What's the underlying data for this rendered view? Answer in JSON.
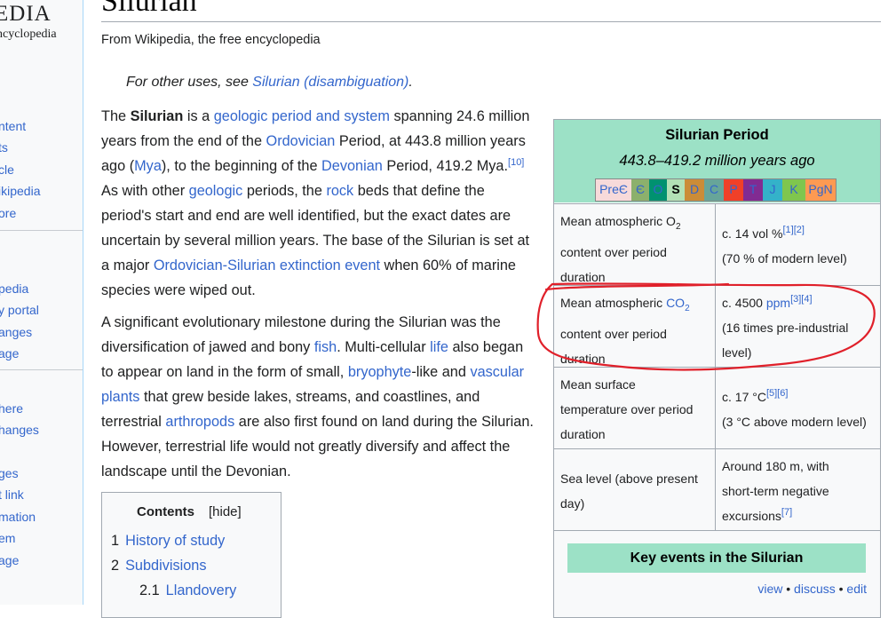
{
  "sidebar": {
    "logo_top": "EDIA",
    "logo_bottom": "ncyclopedia",
    "group1": [
      "ntent",
      "ts",
      "cle",
      "ikipedia",
      "ore"
    ],
    "group2": [
      "pedia",
      "y portal",
      "anges",
      "age"
    ],
    "group3": [
      "here",
      "hanges"
    ],
    "group4": [
      "ges",
      "t link",
      "mation",
      "em",
      "age"
    ]
  },
  "article": {
    "title": "Silurian",
    "tagline": "From Wikipedia, the free encyclopedia",
    "hatnote_prefix": "For other uses, see ",
    "hatnote_link": "Silurian (disambiguation)",
    "hatnote_suffix": ".",
    "p1": [
      "The ",
      "Silurian",
      " is a ",
      "geologic period and system",
      " spanning 24.6 million years from the end of the ",
      "Ordovician",
      " Period, at 443.8 million years ago (",
      "Mya",
      "), to the beginning of the ",
      "Devonian",
      " Period, 419.2 Mya.",
      "[10]",
      " As with other ",
      "geologic",
      " periods, the ",
      "rock",
      " beds that define the period's start and end are well identified, but the exact dates are uncertain by several million years. The base of the Silurian is set at a major ",
      "Ordovician-Silurian extinction event",
      " when 60% of marine species were wiped out."
    ],
    "p2": [
      "A significant evolutionary milestone during the Silurian was the diversification of jawed and bony ",
      "fish",
      ". Multi-cellular ",
      "life",
      " also began to appear on land in the form of small, ",
      "bryophyte",
      "-like and ",
      "vascular plants",
      " that grew beside lakes, streams, and coastlines, and terrestrial ",
      "arthropods",
      " are also first found on land during the Silurian. However, terrestrial life would not greatly diversify and affect the landscape until the Devonian."
    ]
  },
  "toc": {
    "heading": "Contents",
    "hide": "[hide]",
    "items": [
      {
        "num": "1",
        "label": "History of study"
      },
      {
        "num": "2",
        "label": "Subdivisions"
      },
      {
        "num": "2.1",
        "label": "Llandovery"
      }
    ]
  },
  "infobox": {
    "title": "Silurian Period",
    "subtitle": "443.8–419.2 million years ago",
    "timescale": [
      {
        "label": "PreЄ",
        "color": "#f7dada"
      },
      {
        "label": "Є",
        "color": "#8cb06c"
      },
      {
        "label": "O",
        "color": "#009270"
      },
      {
        "label": "S",
        "color": "#b3e1b6"
      },
      {
        "label": "D",
        "color": "#cb8c37"
      },
      {
        "label": "C",
        "color": "#67a599"
      },
      {
        "label": "P",
        "color": "#f04028"
      },
      {
        "label": "T",
        "color": "#812b92"
      },
      {
        "label": "J",
        "color": "#34b2c9"
      },
      {
        "label": "K",
        "color": "#7fc64e"
      },
      {
        "label": "PgN",
        "color": "#fd9a52"
      }
    ],
    "o2_label_a": "Mean atmospheric O",
    "o2_sub": "2",
    "o2_label_b": "content over period",
    "o2_label_c": "duration",
    "o2_val_a": "c. 14 vol %",
    "o2_ref": "[1][2]",
    "o2_val_b": "(70 % of modern level)",
    "co2_label_a": "Mean atmospheric ",
    "co2_link": "CO",
    "co2_sub": "2",
    "co2_label_b": "content over period",
    "co2_label_c": "duration",
    "co2_val_a": "c. 4500 ",
    "co2_ppm": "ppm",
    "co2_ref": "[3][4]",
    "co2_val_b": "(16 times pre-industrial",
    "co2_val_c": "level)",
    "temp_label_a": "Mean surface",
    "temp_label_b": "temperature over period",
    "temp_label_c": "duration",
    "temp_val_a": "c. 17 °C",
    "temp_ref": "[5][6]",
    "temp_val_b": "(3 °C above modern level)",
    "sea_label_a": "Sea level (above present",
    "sea_label_b": "day)",
    "sea_val_a": "Around 180 m, with",
    "sea_val_b": "short-term negative",
    "sea_val_c": "excursions",
    "sea_ref": "[7]",
    "key_events": "Key events in the Silurian",
    "nav_view": "view",
    "nav_dot": " • ",
    "nav_discuss": "discuss",
    "nav_edit": "edit"
  },
  "annotation": {
    "color": "#e0202a"
  }
}
